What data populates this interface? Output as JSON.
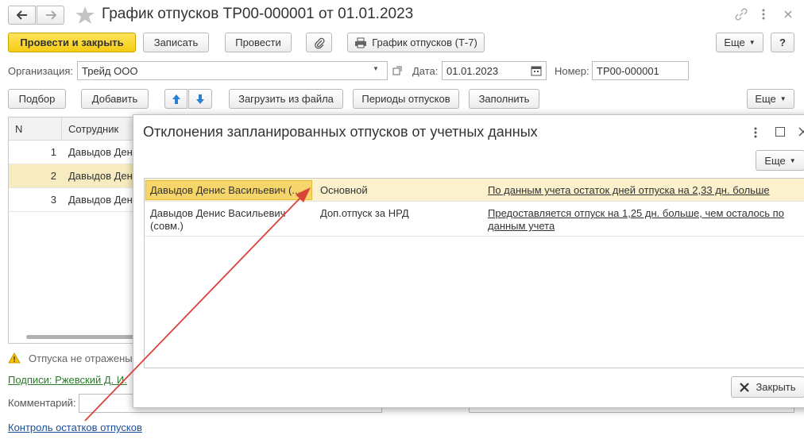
{
  "window": {
    "title": "График отпусков ТР00-000001 от 01.01.2023",
    "back_icon": "arrow-left-icon",
    "forward_icon": "arrow-right-icon",
    "star_icon": "star-icon"
  },
  "toolbar": {
    "post_close": "Провести и закрыть",
    "save": "Записать",
    "post": "Провести",
    "print_schedule": "График отпусков (Т-7)",
    "more": "Еще",
    "help": "?"
  },
  "form": {
    "org_label": "Организация:",
    "org_value": "Трейд ООО",
    "date_label": "Дата:",
    "date_value": "01.01.2023",
    "number_label": "Номер:",
    "number_value": "ТР00-000001"
  },
  "table_toolbar": {
    "pick": "Подбор",
    "add": "Добавить",
    "load_file": "Загрузить из файла",
    "periods": "Периоды отпусков",
    "fill": "Заполнить",
    "more": "Еще"
  },
  "grid": {
    "col_n": "N",
    "col_employee": "Сотрудник",
    "rows": [
      {
        "n": "1",
        "employee": "Давыдов Денис Васильевич"
      },
      {
        "n": "2",
        "employee": "Давыдов Денис Васильевич (совм.)"
      },
      {
        "n": "3",
        "employee": "Давыдов Денис Васильевич"
      }
    ]
  },
  "footer": {
    "warning": "Отпуска не отражены",
    "signatures": "Подписи: Ржевский Д. И.",
    "comment_label": "Комментарий:",
    "control_link": "Контроль остатков отпусков"
  },
  "modal": {
    "title": "Отклонения запланированных отпусков от учетных данных",
    "more": "Еще",
    "close": "Закрыть",
    "rows": [
      {
        "employee": "Давыдов Денис Васильевич (...",
        "type": "Основной",
        "message": "По данным учета остаток дней отпуска на 2,33 дн. больше"
      },
      {
        "employee": "Давыдов Денис Васильевич (совм.)",
        "type": "Доп.отпуск за НРД",
        "message": "Предоставляется отпуск на 1,25 дн. больше, чем осталось по данным учета"
      }
    ]
  },
  "colors": {
    "primary_button": "#f5cc13",
    "selected_row": "#f7ecbf",
    "arrow": "#d9433a",
    "link_green": "#2a7a2a",
    "link_blue": "#1a4e9a"
  }
}
